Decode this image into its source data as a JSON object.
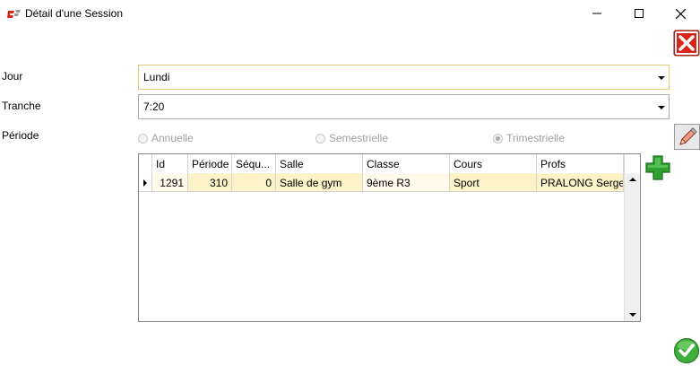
{
  "window": {
    "title": "Détail d'une Session"
  },
  "form": {
    "jour_label": "Jour",
    "jour_value": "Lundi",
    "tranche_label": "Tranche",
    "tranche_value": "7:20",
    "periode_label": "Période",
    "periode_options": [
      "Annuelle",
      "Semestrielle",
      "Trimestrielle"
    ],
    "periode_selected": "Trimestrielle"
  },
  "grid": {
    "columns": [
      "Id",
      "Période",
      "Séqu...",
      "Salle",
      "Classe",
      "Cours",
      "Profs"
    ],
    "rows": [
      [
        "1291",
        "310",
        "0",
        "Salle de gym",
        "9ème R3",
        "Sport",
        "PRALONG Serge"
      ]
    ]
  },
  "icons": {
    "close_dialog": "close-red-x-icon",
    "edit": "pencil-edit-icon",
    "add": "green-plus-icon",
    "confirm": "green-check-icon"
  },
  "colors": {
    "close_red": "#d9261c",
    "add_green": "#2ea12e",
    "confirm_green": "#3fae3a",
    "row_highlight": "#fdf2c8"
  }
}
